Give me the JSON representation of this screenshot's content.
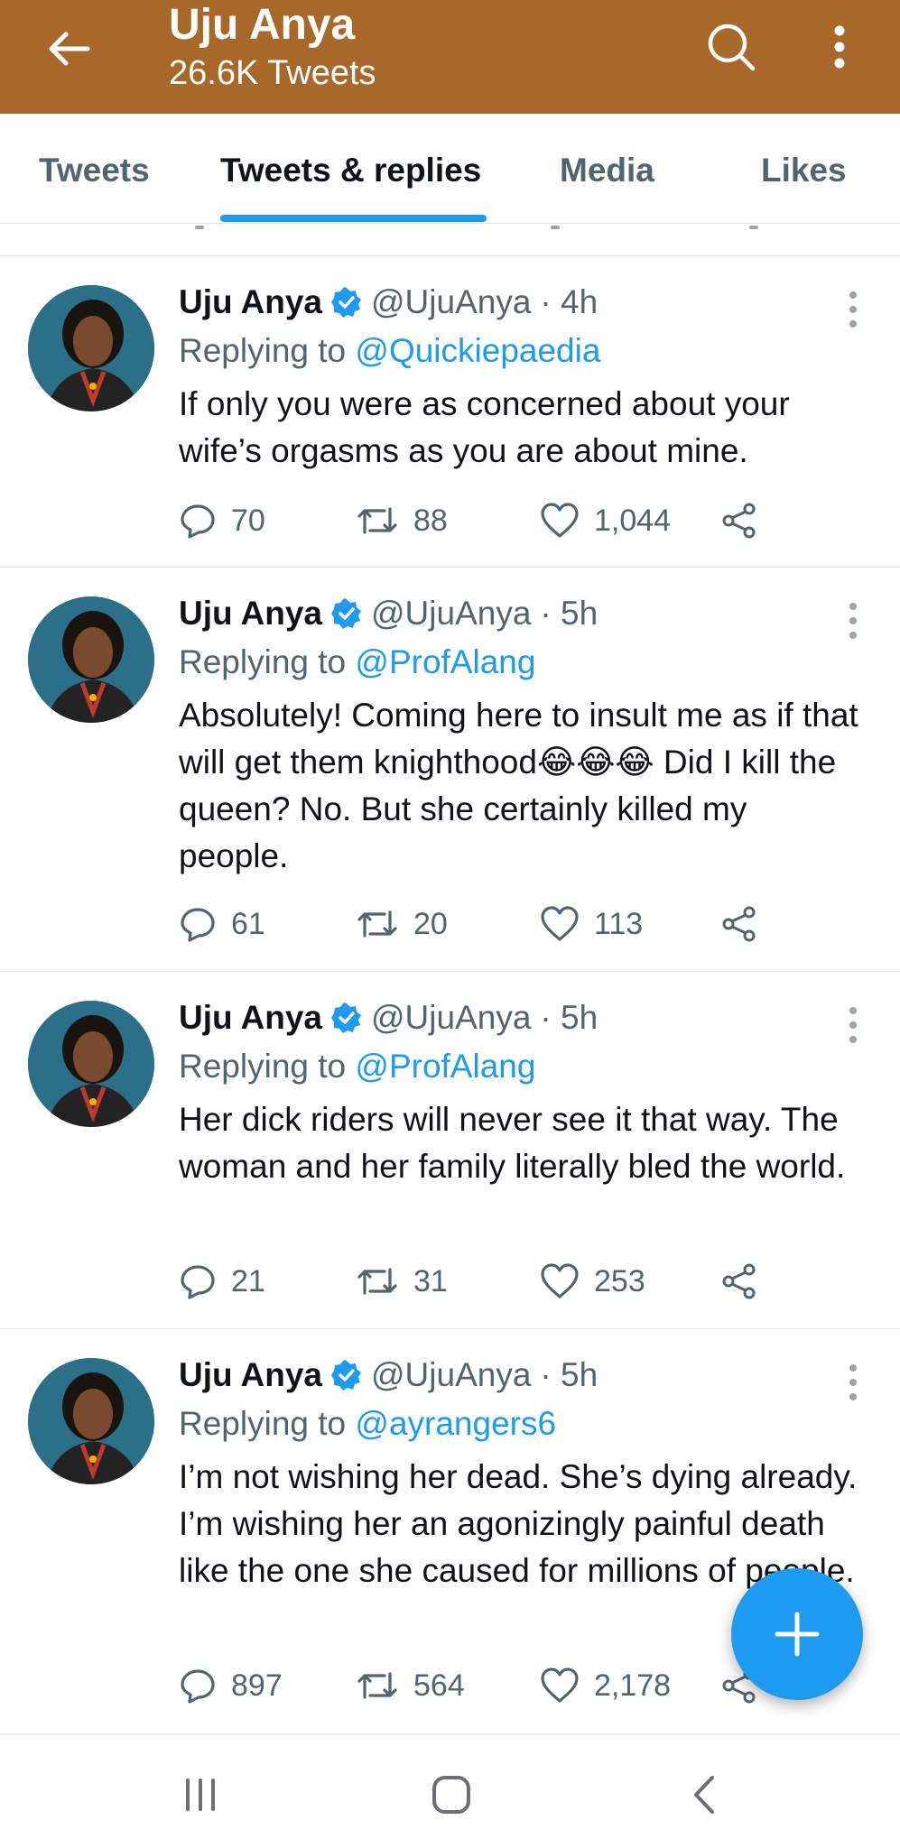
{
  "header": {
    "title": "Uju Anya",
    "subtitle": "26.6K Tweets",
    "background_color": "#a8682a"
  },
  "tabs": [
    {
      "label": "Tweets",
      "active": false
    },
    {
      "label": "Tweets & replies",
      "active": true
    },
    {
      "label": "Media",
      "active": false
    },
    {
      "label": "Likes",
      "active": false
    }
  ],
  "tweets": [
    {
      "author": "Uju Anya",
      "handle": "@UjuAnya",
      "time": "· 4h",
      "replying_prefix": "Replying to",
      "replying_to": "@Quickiepaedia",
      "text": "If only you were as concerned about your wife’s orgasms as you are about mine.",
      "replies": "70",
      "retweets": "88",
      "likes": "1,044"
    },
    {
      "author": "Uju Anya",
      "handle": "@UjuAnya",
      "time": "· 5h",
      "replying_prefix": "Replying to",
      "replying_to": "@ProfAlang",
      "text": "Absolutely! Coming here to insult me as if that will get them knighthood😂😂😂 Did I kill the queen? No. But she certainly killed my people.",
      "replies": "61",
      "retweets": "20",
      "likes": "113"
    },
    {
      "author": "Uju Anya",
      "handle": "@UjuAnya",
      "time": "· 5h",
      "replying_prefix": "Replying to",
      "replying_to": "@ProfAlang",
      "text": "Her dick riders will never see it that way. The woman and her family literally bled the world.",
      "replies": "21",
      "retweets": "31",
      "likes": "253"
    },
    {
      "author": "Uju Anya",
      "handle": "@UjuAnya",
      "time": "· 5h",
      "replying_prefix": "Replying to",
      "replying_to": "@ayrangers6",
      "text": "I’m not wishing her dead. She’s dying already. I’m wishing her an agonizingly painful death like the one she caused for millions of people.",
      "replies": "897",
      "retweets": "564",
      "likes": "2,178"
    }
  ],
  "icons": {
    "back": "arrow-left-icon",
    "search": "search-icon",
    "more": "more-vertical-icon",
    "verified": "verified-badge-icon",
    "reply": "reply-icon",
    "retweet": "retweet-icon",
    "like": "heart-icon",
    "share": "share-icon",
    "compose": "plus-icon",
    "nav_recents": "recents-icon",
    "nav_home": "home-icon",
    "nav_back": "nav-back-icon"
  },
  "colors": {
    "accent": "#1d9bf0",
    "secondary_text": "#536471"
  }
}
